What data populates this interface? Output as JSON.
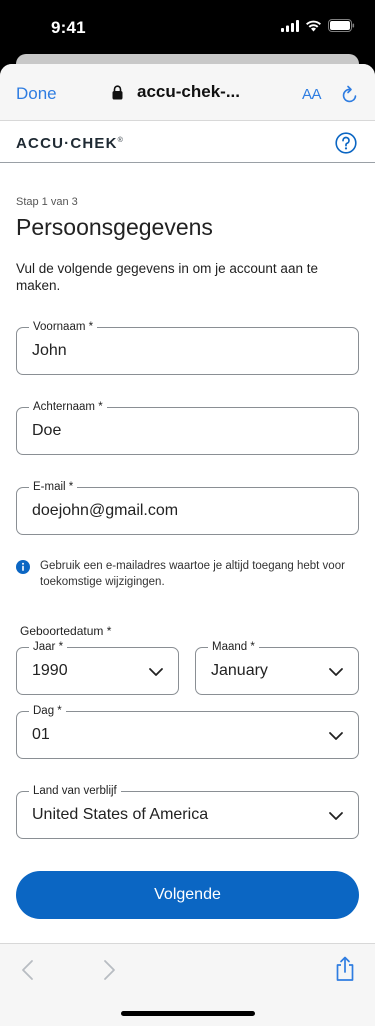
{
  "status_bar": {
    "time": "9:41"
  },
  "browser": {
    "done_label": "Done",
    "url": "accu-chek-...",
    "text_size_label": "AA"
  },
  "site": {
    "logo_text": "ACCU·CHEK",
    "logo_mark": "®"
  },
  "form": {
    "step": "Stap 1 van 3",
    "title": "Persoonsgegevens",
    "intro": "Vul de volgende gegevens in om je account aan te maken.",
    "first_name": {
      "label": "Voornaam *",
      "value": "John"
    },
    "last_name": {
      "label": "Achternaam *",
      "value": "Doe"
    },
    "email": {
      "label": "E-mail *",
      "value": "doejohn@gmail.com"
    },
    "email_info": "Gebruik een e-mailadres waartoe je altijd toegang hebt voor toekomstige wijzigingen.",
    "birthdate_label": "Geboortedatum *",
    "year": {
      "label": "Jaar *",
      "value": "1990"
    },
    "month": {
      "label": "Maand *",
      "value": "January"
    },
    "day": {
      "label": "Dag *",
      "value": "01"
    },
    "country": {
      "label": "Land van verblijf",
      "value": "United States of America"
    },
    "next_label": "Volgende"
  },
  "colors": {
    "primary": "#0b66c3",
    "link": "#2f7de1",
    "text": "#222222"
  }
}
